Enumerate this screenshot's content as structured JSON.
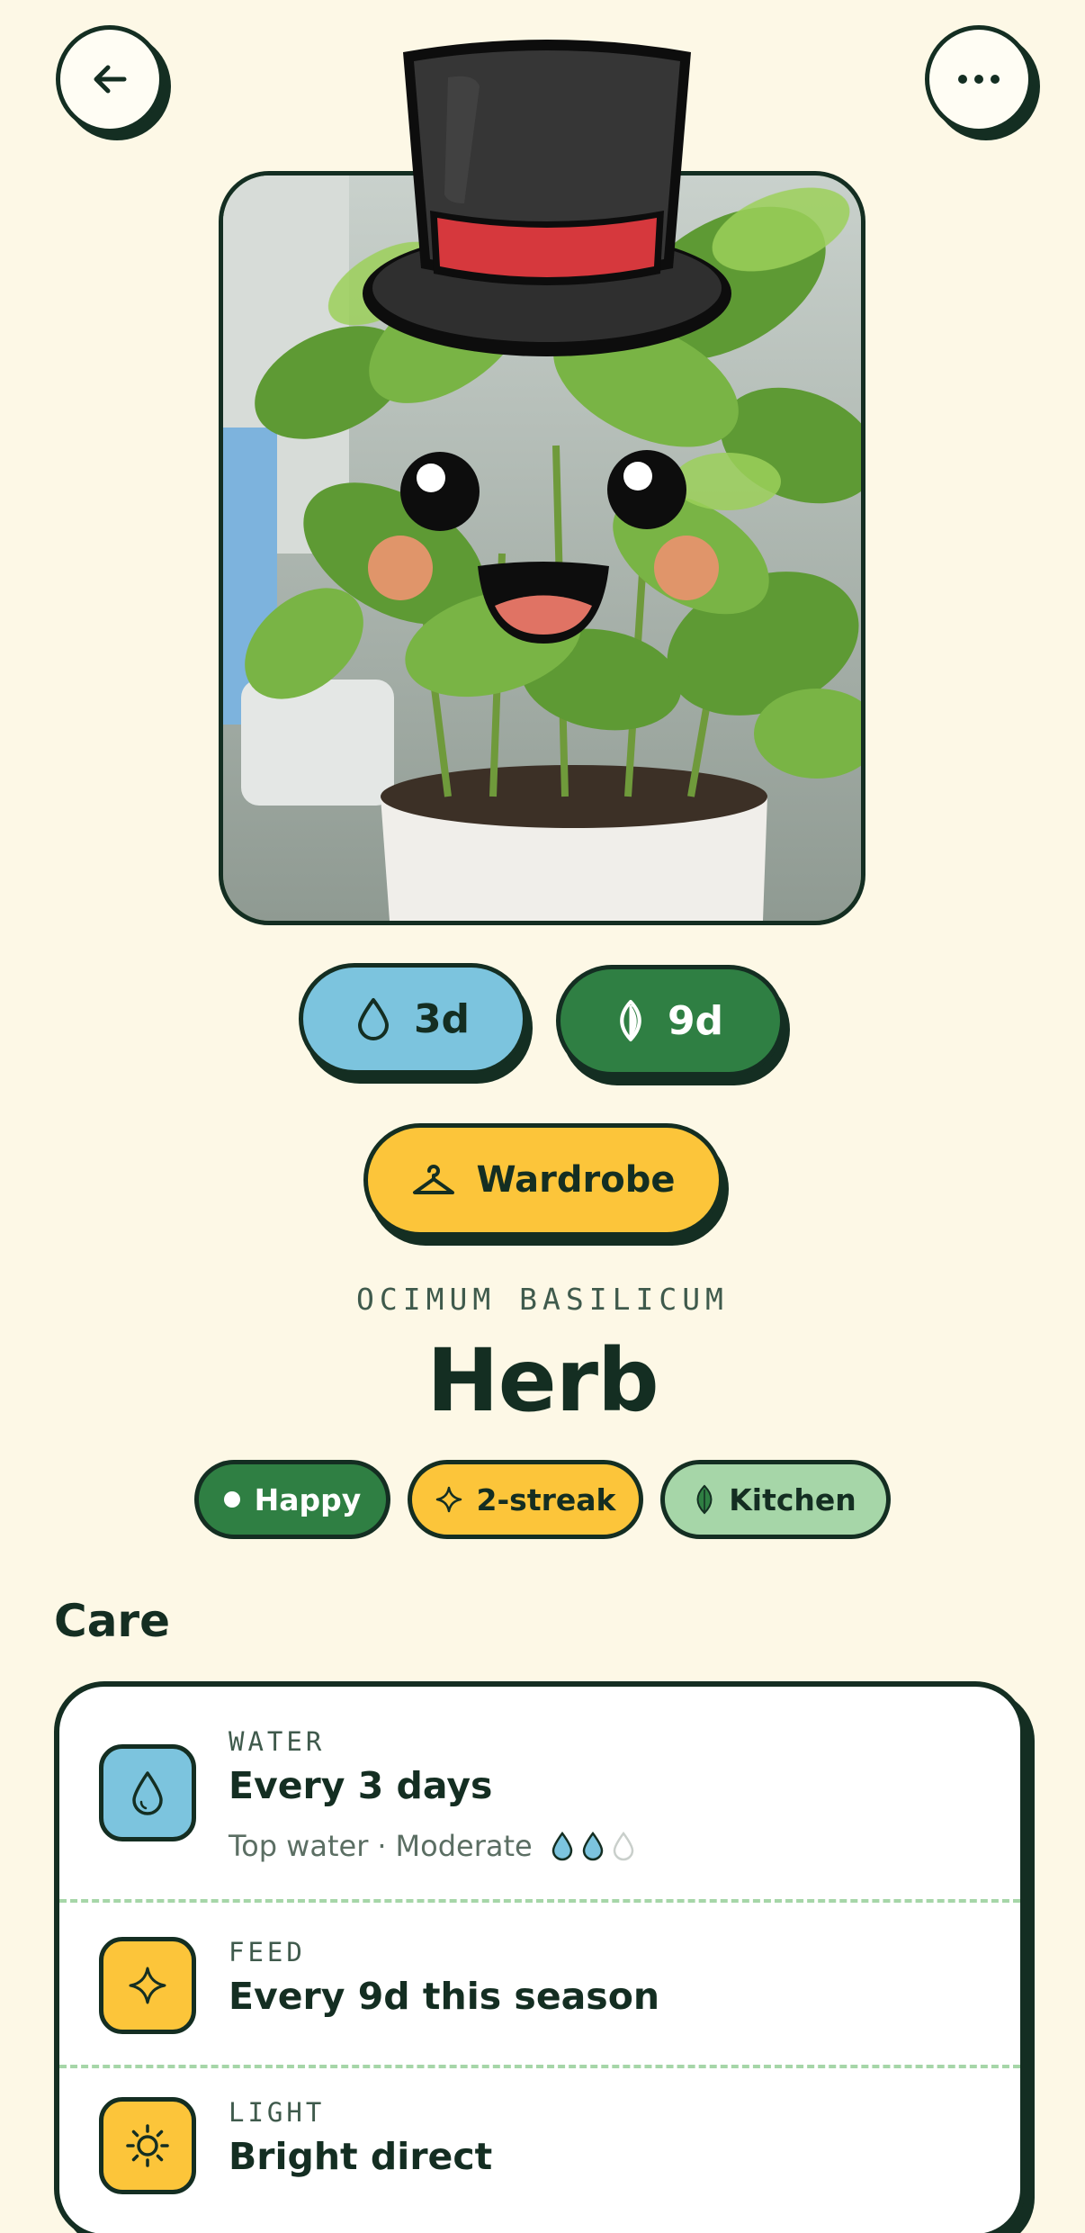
{
  "header": {
    "back_icon": "arrow-left-icon",
    "more_icon": "more-horizontal-icon"
  },
  "stats": {
    "water_label": "3d",
    "feed_label": "9d"
  },
  "wardrobe": {
    "label": "Wardrobe",
    "icon": "hanger-icon"
  },
  "plant": {
    "species": "OCIMUM BASILICUM",
    "name": "Herb"
  },
  "tags": {
    "mood": "Happy",
    "streak": "2-streak",
    "room": "Kitchen"
  },
  "care": {
    "title": "Care",
    "water": {
      "label": "WATER",
      "value": "Every 3 days",
      "method": "Top water",
      "separator": "·",
      "amount": "Moderate",
      "amount_level": 2,
      "amount_max": 3
    },
    "feed": {
      "label": "FEED",
      "value": "Every 9d this season"
    },
    "light": {
      "label": "LIGHT",
      "value": "Bright direct"
    }
  },
  "colors": {
    "background": "#fdf8e6",
    "ink": "#142e22",
    "water_blue": "#7cc4de",
    "leaf_green": "#2f7f43",
    "sun_yellow": "#fcc53a",
    "mint": "#a6d6a8"
  }
}
